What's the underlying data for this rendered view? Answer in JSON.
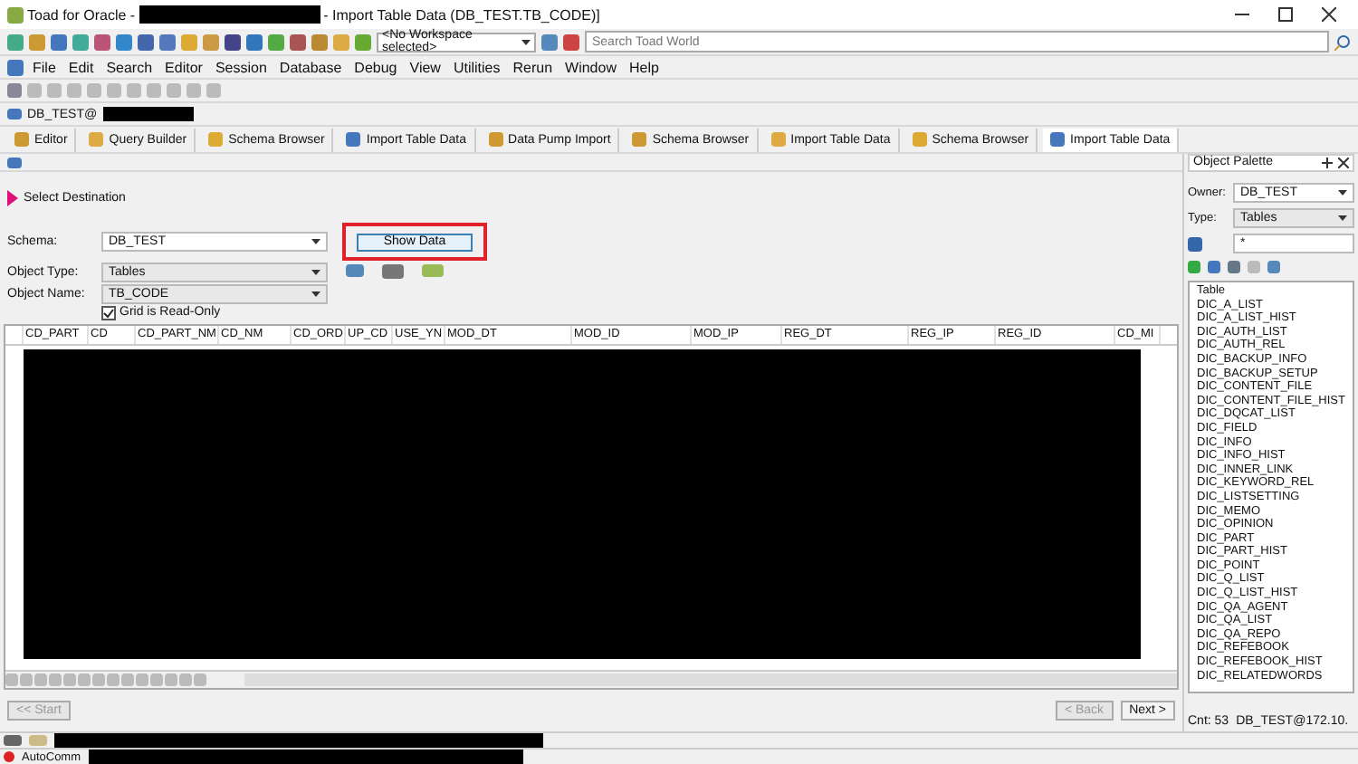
{
  "window": {
    "title_prefix": "Toad for Oracle -",
    "title_suffix": "- Import Table Data (DB_TEST.TB_CODE)]"
  },
  "workspace": {
    "value": "<No Workspace selected>"
  },
  "search": {
    "placeholder": "Search Toad World"
  },
  "menu": [
    "File",
    "Edit",
    "Search",
    "Editor",
    "Session",
    "Database",
    "Debug",
    "View",
    "Utilities",
    "Rerun",
    "Window",
    "Help"
  ],
  "connection": {
    "label": "DB_TEST@"
  },
  "tabs": [
    {
      "label": "Editor",
      "selected": false
    },
    {
      "label": "Query Builder",
      "selected": false
    },
    {
      "label": "Schema Browser",
      "selected": false
    },
    {
      "label": "Import Table Data",
      "selected": false
    },
    {
      "label": "Data Pump Import",
      "selected": false
    },
    {
      "label": "Schema Browser",
      "selected": false
    },
    {
      "label": "Import Table Data",
      "selected": false
    },
    {
      "label": "Schema Browser",
      "selected": false
    },
    {
      "label": "Import Table Data",
      "selected": true
    }
  ],
  "wizard": {
    "step": "Select Destination",
    "schema_label": "Schema:",
    "schema": "DB_TEST",
    "type_label": "Object Type:",
    "type": "Tables",
    "name_label": "Object Name:",
    "name": "TB_CODE",
    "show_button": "Show Data",
    "read_only": {
      "label": "Grid is Read-Only",
      "checked": true
    }
  },
  "grid": {
    "columns": [
      "CD_PART",
      "CD",
      "CD_PART_NM",
      "CD_NM",
      "CD_ORD",
      "UP_CD",
      "USE_YN",
      "MOD_DT",
      "MOD_ID",
      "MOD_IP",
      "REG_DT",
      "REG_IP",
      "REG_ID",
      "CD_MI"
    ]
  },
  "buttons": [
    {
      "label": "<< Start",
      "disabled": true
    },
    {
      "label": "< Back",
      "disabled": true
    },
    {
      "label": "Next >",
      "disabled": false
    }
  ],
  "palette": {
    "title": "Object Palette",
    "owner_label": "Owner:",
    "owner": "DB_TEST",
    "type_label": "Type:",
    "type": "Tables",
    "filter": "*",
    "list_header": "Table",
    "items": [
      "DIC_A_LIST",
      "DIC_A_LIST_HIST",
      "DIC_AUTH_LIST",
      "DIC_AUTH_REL",
      "DIC_BACKUP_INFO",
      "DIC_BACKUP_SETUP",
      "DIC_CONTENT_FILE",
      "DIC_CONTENT_FILE_HIST",
      "DIC_DQCAT_LIST",
      "DIC_FIELD",
      "DIC_INFO",
      "DIC_INFO_HIST",
      "DIC_INNER_LINK",
      "DIC_KEYWORD_REL",
      "DIC_LISTSETTING",
      "DIC_MEMO",
      "DIC_OPINION",
      "DIC_PART",
      "DIC_PART_HIST",
      "DIC_POINT",
      "DIC_Q_LIST",
      "DIC_Q_LIST_HIST",
      "DIC_QA_AGENT",
      "DIC_QA_LIST",
      "DIC_QA_REPO",
      "DIC_REFEBOOK",
      "DIC_REFEBOOK_HIST",
      "DIC_RELATEDWORDS"
    ],
    "count": "Cnt: 53",
    "connection": "DB_TEST@172.10."
  },
  "status": {
    "autocommit": "AutoComm"
  }
}
